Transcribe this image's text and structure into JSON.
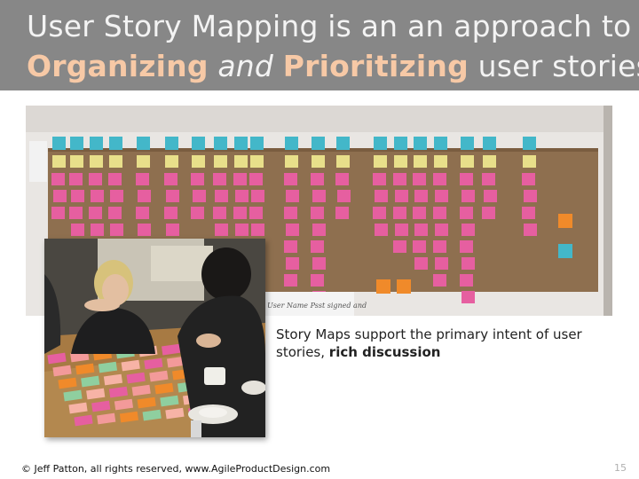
{
  "slide": {
    "title_line1": "User Story Mapping is an an approach to",
    "title_word1": "Organizing",
    "title_word2": "and",
    "title_word3": "Prioritizing",
    "title_tail": "user stories",
    "caption_text": "Story Maps support the primary intent of user stories, ",
    "caption_bold": "rich discussion",
    "footer": "© Jeff Patton, all rights reserved, www.AgileProductDesign.com",
    "page_number": "15",
    "wall_note_text": "User Name Psst signed and"
  },
  "colors": {
    "title_bar": "#878787",
    "title_text": "#f3f3f3",
    "title_highlight": "#f7c9a6",
    "kraft_paper": "#8e6f4f",
    "wall": "#e9e6e3",
    "note_blue": "#43b7c9",
    "note_yellow": "#e8df8a",
    "note_pink": "#e65fa0",
    "note_orange": "#f08a2a"
  }
}
